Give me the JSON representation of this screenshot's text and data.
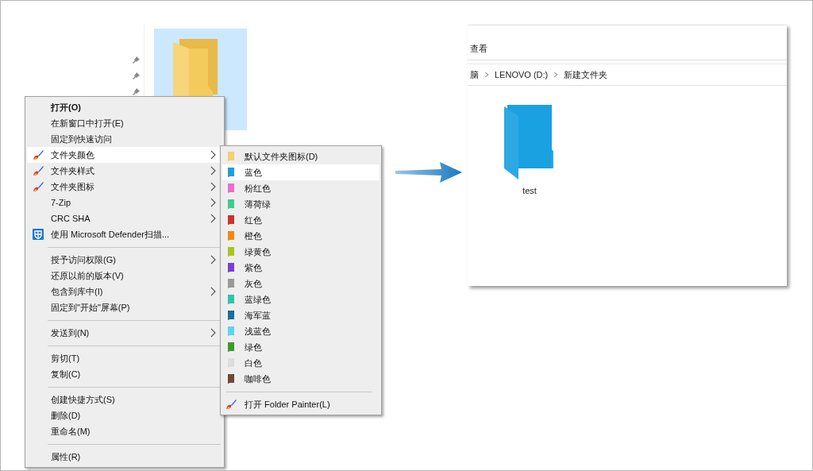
{
  "explorer": {
    "folder": {
      "selected": true
    }
  },
  "context_menu": {
    "items": [
      {
        "kind": "plain",
        "label": "打开(O)",
        "default": true,
        "submenu": false,
        "selected": false
      },
      {
        "kind": "plain",
        "label": "在新窗口中打开(E)",
        "default": false,
        "submenu": false,
        "selected": false
      },
      {
        "kind": "plain",
        "label": "固定到快速访问",
        "default": false,
        "submenu": false,
        "selected": false
      },
      {
        "kind": "brush",
        "label": "文件夹颜色",
        "default": false,
        "submenu": true,
        "selected": true
      },
      {
        "kind": "brush",
        "label": "文件夹样式",
        "default": false,
        "submenu": true,
        "selected": false
      },
      {
        "kind": "brush",
        "label": "文件夹图标",
        "default": false,
        "submenu": true,
        "selected": false
      },
      {
        "kind": "plain",
        "label": "7-Zip",
        "default": false,
        "submenu": true,
        "selected": false
      },
      {
        "kind": "plain",
        "label": "CRC SHA",
        "default": false,
        "submenu": true,
        "selected": false
      },
      {
        "kind": "shield",
        "label": "使用 Microsoft Defender扫描...",
        "default": false,
        "submenu": false,
        "selected": false
      },
      {
        "kind": "separator"
      },
      {
        "kind": "plain",
        "label": "授予访问权限(G)",
        "default": false,
        "submenu": true,
        "selected": false
      },
      {
        "kind": "plain",
        "label": "还原以前的版本(V)",
        "default": false,
        "submenu": false,
        "selected": false
      },
      {
        "kind": "plain",
        "label": "包含到库中(I)",
        "default": false,
        "submenu": true,
        "selected": false
      },
      {
        "kind": "plain",
        "label": "固定到\"开始\"屏幕(P)",
        "default": false,
        "submenu": false,
        "selected": false
      },
      {
        "kind": "separator"
      },
      {
        "kind": "plain",
        "label": "发送到(N)",
        "default": false,
        "submenu": true,
        "selected": false
      },
      {
        "kind": "separator"
      },
      {
        "kind": "plain",
        "label": "剪切(T)",
        "default": false,
        "submenu": false,
        "selected": false
      },
      {
        "kind": "plain",
        "label": "复制(C)",
        "default": false,
        "submenu": false,
        "selected": false
      },
      {
        "kind": "separator"
      },
      {
        "kind": "plain",
        "label": "创建快捷方式(S)",
        "default": false,
        "submenu": false,
        "selected": false
      },
      {
        "kind": "plain",
        "label": "删除(D)",
        "default": false,
        "submenu": false,
        "selected": false
      },
      {
        "kind": "plain",
        "label": "重命名(M)",
        "default": false,
        "submenu": false,
        "selected": false
      },
      {
        "kind": "separator"
      },
      {
        "kind": "plain",
        "label": "属性(R)",
        "default": false,
        "submenu": false,
        "selected": false
      }
    ]
  },
  "submenu": {
    "items": [
      {
        "kind": "color",
        "label": "默认文件夹图标(D)",
        "color": "#f5cf6e",
        "selected": false
      },
      {
        "kind": "color",
        "label": "蓝色",
        "color": "#1e9fd8",
        "selected": true
      },
      {
        "kind": "color",
        "label": "粉红色",
        "color": "#e96ed0",
        "selected": false
      },
      {
        "kind": "color",
        "label": "薄荷绿",
        "color": "#3dcc8e",
        "selected": false
      },
      {
        "kind": "color",
        "label": "红色",
        "color": "#d0312d",
        "selected": false
      },
      {
        "kind": "color",
        "label": "橙色",
        "color": "#ee8a10",
        "selected": false
      },
      {
        "kind": "color",
        "label": "绿黄色",
        "color": "#a8c520",
        "selected": false
      },
      {
        "kind": "color",
        "label": "紫色",
        "color": "#7b3fd4",
        "selected": false
      },
      {
        "kind": "color",
        "label": "灰色",
        "color": "#9a9a9a",
        "selected": false
      },
      {
        "kind": "color",
        "label": "蓝绿色",
        "color": "#2ec4b0",
        "selected": false
      },
      {
        "kind": "color",
        "label": "海军蓝",
        "color": "#1a6e9a",
        "selected": false
      },
      {
        "kind": "color",
        "label": "浅蓝色",
        "color": "#5ed6ea",
        "selected": false
      },
      {
        "kind": "color",
        "label": "绿色",
        "color": "#3a9d2a",
        "selected": false
      },
      {
        "kind": "color",
        "label": "白色",
        "color": "#dddddd",
        "selected": false
      },
      {
        "kind": "color",
        "label": "咖啡色",
        "color": "#6e4a3a",
        "selected": false
      },
      {
        "kind": "separator"
      },
      {
        "kind": "painter",
        "label": "打开 Folder Painter(L)",
        "selected": false
      }
    ]
  },
  "result_window": {
    "ribbon_tab": "查看",
    "breadcrumb": [
      "脑",
      "LENOVO (D:)",
      "新建文件夹"
    ],
    "items": [
      {
        "name": "test",
        "color": "#1ba1e2"
      }
    ]
  }
}
